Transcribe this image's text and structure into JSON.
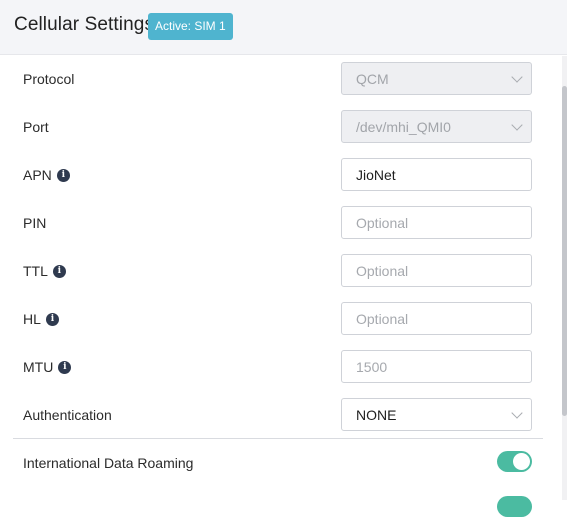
{
  "header": {
    "title": "Cellular Settings",
    "badge": "Active: SIM 1"
  },
  "fields": {
    "protocol": {
      "label": "Protocol",
      "value": "QCM"
    },
    "port": {
      "label": "Port",
      "value": "/dev/mhi_QMI0"
    },
    "apn": {
      "label": "APN",
      "value": "JioNet"
    },
    "pin": {
      "label": "PIN",
      "placeholder": "Optional"
    },
    "ttl": {
      "label": "TTL",
      "placeholder": "Optional"
    },
    "hl": {
      "label": "HL",
      "placeholder": "Optional"
    },
    "mtu": {
      "label": "MTU",
      "placeholder": "1500"
    },
    "authentication": {
      "label": "Authentication",
      "value": "NONE"
    }
  },
  "roaming": {
    "label": "International Data Roaming",
    "enabled": true
  },
  "info_glyph": "i",
  "colors": {
    "accent": "#4bbba1",
    "badge": "#4fb4cf"
  }
}
